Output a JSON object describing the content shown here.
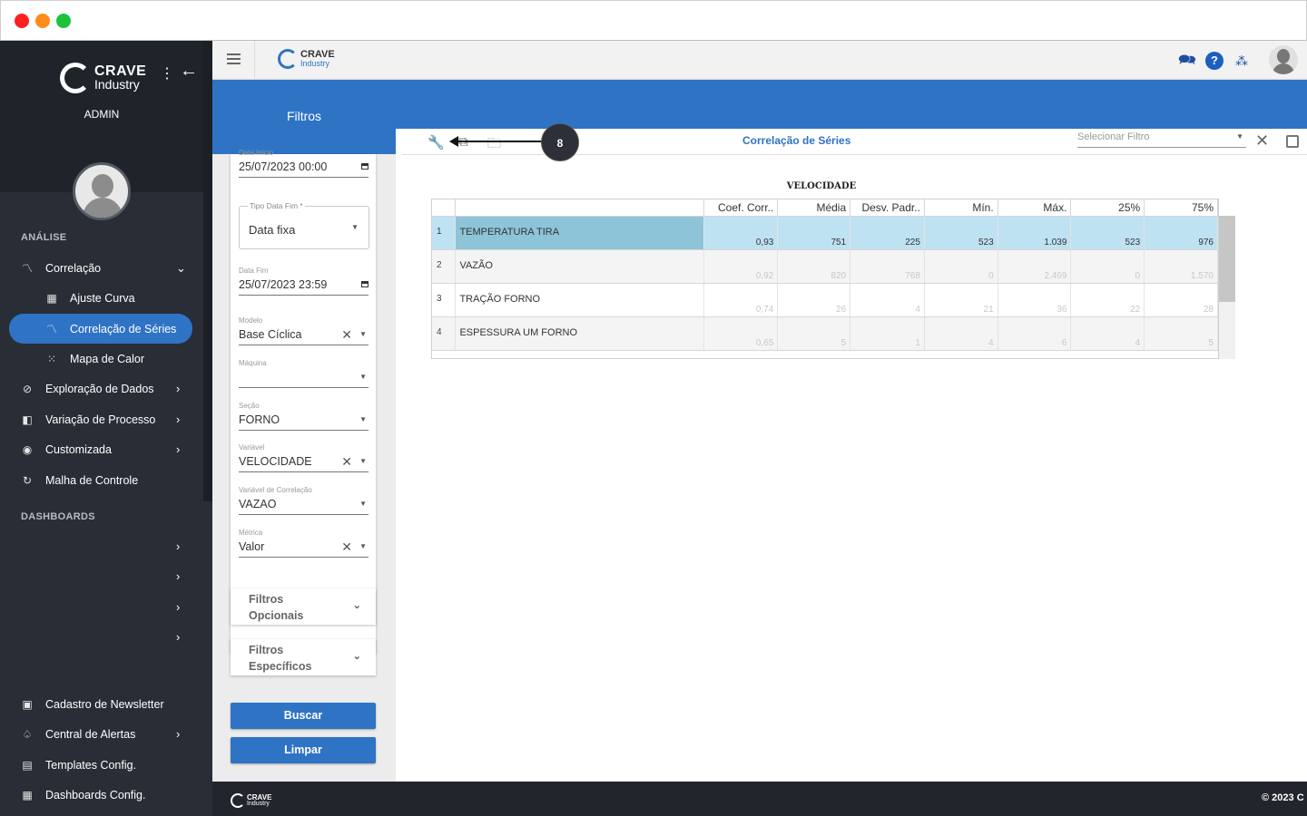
{
  "brand": {
    "name": "CRAVE",
    "sub": "Industry"
  },
  "sidebar": {
    "role": "ADMIN",
    "section_analise": "ANÁLISE",
    "section_dashboards": "DASHBOARDS",
    "items": [
      {
        "label": "Correlação",
        "icon": "chart-icon",
        "chevron": "⌄"
      },
      {
        "label": "Ajuste Curva",
        "icon": "grid-icon"
      },
      {
        "label": "Correlação de Séries",
        "icon": "chart-icon"
      },
      {
        "label": "Mapa de Calor",
        "icon": "heatmap-icon"
      },
      {
        "label": "Exploração de Dados",
        "icon": "compass-icon",
        "chevron": "›"
      },
      {
        "label": "Variação de Processo",
        "icon": "process-icon",
        "chevron": "›"
      },
      {
        "label": "Customizada",
        "icon": "palette-icon",
        "chevron": "›"
      },
      {
        "label": "Malha de Controle",
        "icon": "loop-icon"
      }
    ],
    "bottom_items": [
      {
        "label": "Cadastro de Newsletter",
        "icon": "newsletter-icon"
      },
      {
        "label": "Central de Alertas",
        "icon": "bell-icon",
        "chevron": "›"
      },
      {
        "label": "Templates Config.",
        "icon": "template-icon"
      },
      {
        "label": "Dashboards Config.",
        "icon": "dashboard-icon"
      }
    ],
    "dashboard_chevron": "›"
  },
  "filters": {
    "title": "Filtros",
    "data_inicio_label": "Data Início",
    "data_inicio": "25/07/2023 00:00",
    "tipo_data_fim_label": "Tipo Data Fim *",
    "tipo_data_fim": "Data fixa",
    "data_fim_label": "Data Fim",
    "data_fim": "25/07/2023 23:59",
    "modelo_label": "Modelo",
    "modelo": "Base Cíclica",
    "maquina_label": "Máquina",
    "maquina": "",
    "secao_label": "Seção",
    "secao": "FORNO",
    "variavel_label": "Variável",
    "variavel": "VELOCIDADE",
    "var_corr_label": "Variável de Correlação",
    "var_corr": "VAZAO",
    "metrica_label": "Métrica",
    "metrica": "Valor",
    "opcionais_l1": "Filtros",
    "opcionais_l2": "Opcionais",
    "especificos_l1": "Filtros",
    "especificos_l2": "Específicos",
    "buscar": "Buscar",
    "limpar": "Limpar"
  },
  "main": {
    "title": "Correlação de Séries",
    "select_placeholder": "Selecionar Filtro",
    "callout": "8",
    "table_title": "VELOCIDADE",
    "columns": [
      "Coef. Corr..",
      "Média",
      "Desv. Padr..",
      "Mín.",
      "Máx.",
      "25%",
      "75%"
    ],
    "rows": [
      {
        "idx": "1",
        "name": "TEMPERATURA TIRA",
        "values": [
          "0,93",
          "751",
          "225",
          "523",
          "1.039",
          "523",
          "976"
        ]
      },
      {
        "idx": "2",
        "name": "VAZÃO",
        "values": [
          "0,92",
          "820",
          "768",
          "0",
          "2.469",
          "0",
          "1.570"
        ]
      },
      {
        "idx": "3",
        "name": "TRAÇÃO FORNO",
        "values": [
          "0,74",
          "26",
          "4",
          "21",
          "36",
          "22",
          "28"
        ]
      },
      {
        "idx": "4",
        "name": "ESPESSURA UM FORNO",
        "values": [
          "0,65",
          "5",
          "1",
          "4",
          "6",
          "4",
          "5"
        ]
      }
    ]
  },
  "footer": {
    "copyright": "© 2023 C"
  },
  "colors": {
    "accent": "#2f73c5",
    "sidebar": "#282d36",
    "selected_row": "#bfe2f2"
  }
}
